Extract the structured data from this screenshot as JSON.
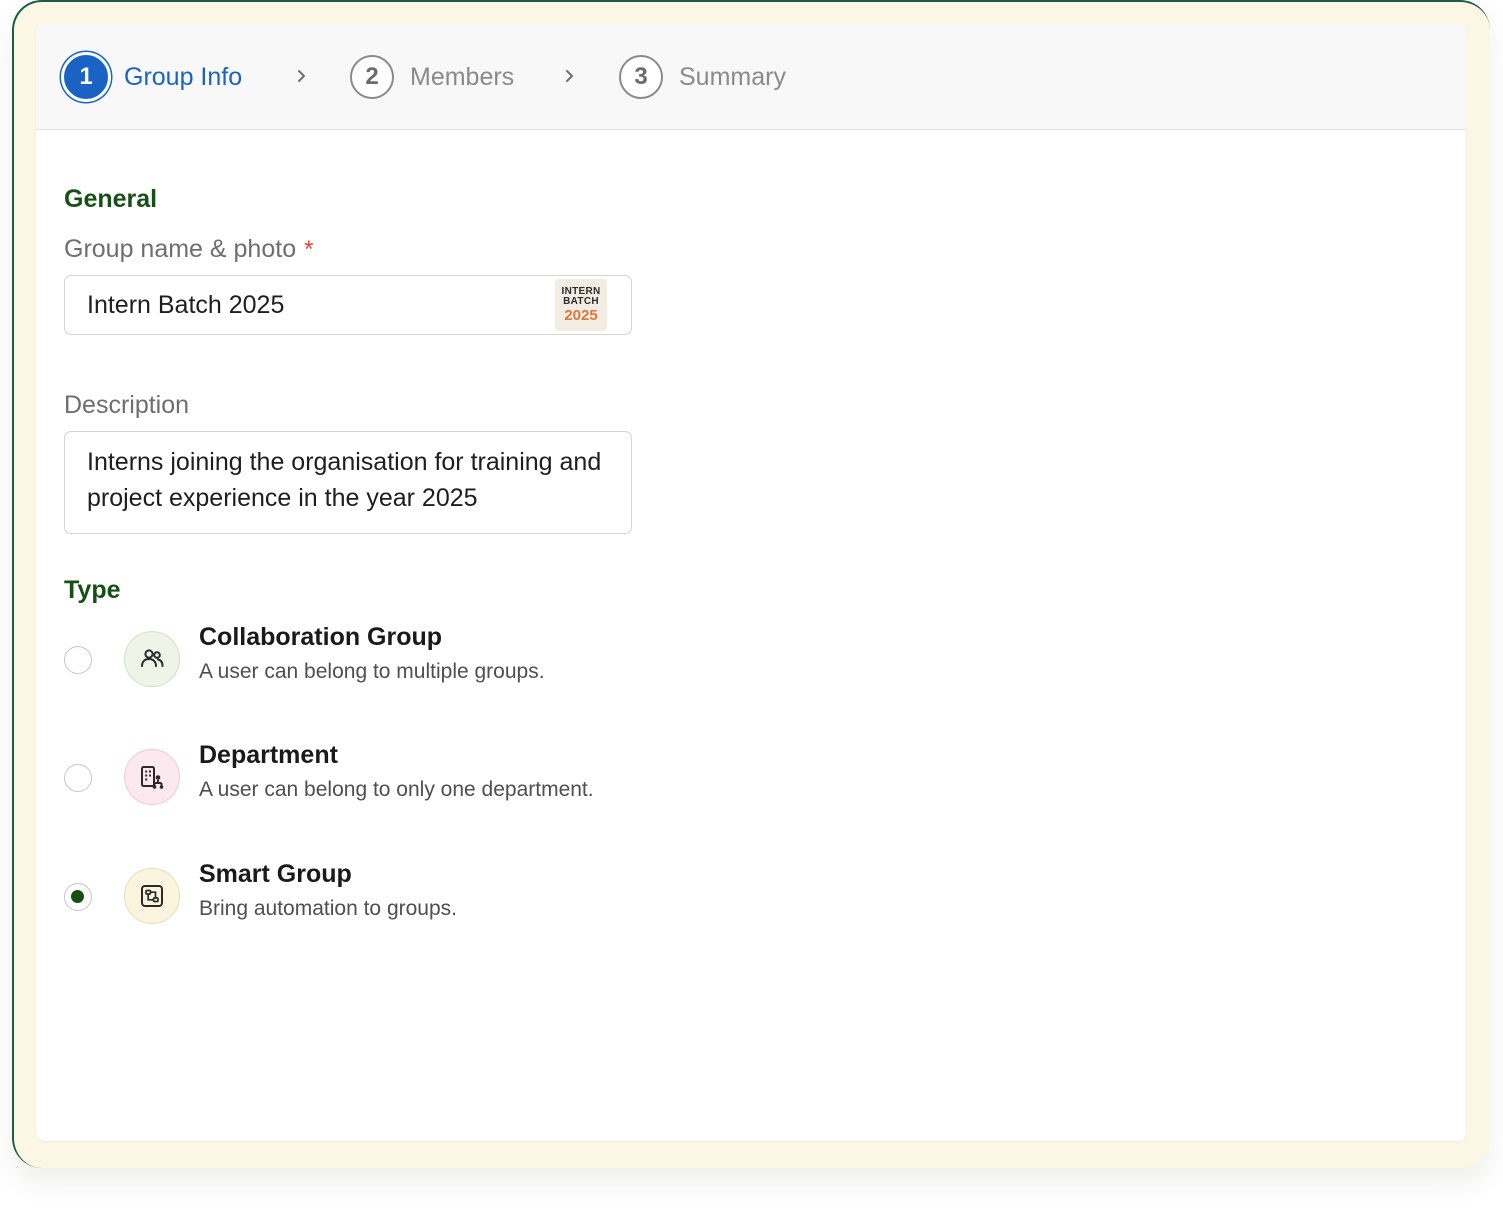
{
  "steps": [
    {
      "number": "1",
      "label": "Group Info"
    },
    {
      "number": "2",
      "label": "Members"
    },
    {
      "number": "3",
      "label": "Summary"
    }
  ],
  "general": {
    "section_title": "General",
    "name_label": "Group name & photo",
    "required_mark": "*",
    "name_value": "Intern Batch 2025",
    "photo": {
      "line1": "INTERN",
      "line2": "BATCH",
      "line3": "2025"
    },
    "description_label": "Description",
    "description_value": "Interns joining the organisation for training and project experience in the year 2025"
  },
  "type": {
    "section_title": "Type",
    "selected": "Smart Group",
    "options": [
      {
        "title": "Collaboration Group",
        "description": "A user can belong to multiple groups.",
        "icon": "users-icon"
      },
      {
        "title": "Department",
        "description": "A user can belong to only one department.",
        "icon": "department-building-icon"
      },
      {
        "title": "Smart Group",
        "description": "Bring automation to groups.",
        "icon": "automation-icon"
      }
    ]
  },
  "colors": {
    "accent_blue": "#1a63c4",
    "section_green": "#175016",
    "required_red": "#e0463e",
    "frame_cream": "#fbf7e4"
  }
}
